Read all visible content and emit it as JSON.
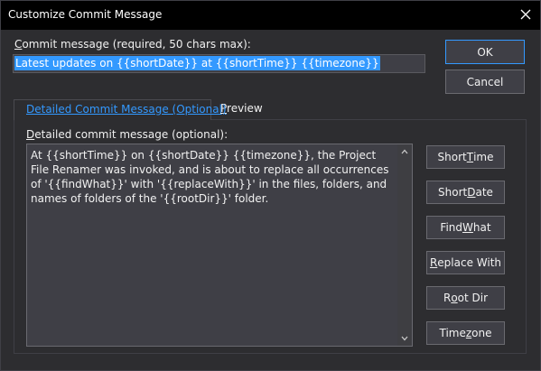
{
  "window": {
    "title": "Customize Commit Message"
  },
  "commit": {
    "label_accel": "C",
    "label_rest": "ommit message (required, 50 chars max):",
    "value": "Latest updates on {{shortDate}} at {{shortTime}} {{timezone}}"
  },
  "buttons": {
    "ok": "OK",
    "cancel": "Cancel"
  },
  "tabs": {
    "detailed": "Detailed Commit Message (Optional)",
    "preview_accel": "P",
    "preview_rest": "review"
  },
  "detail": {
    "label_accel": "D",
    "label_rest": "etailed commit message (optional):",
    "value": "At {{shortTime}} on {{shortDate}} {{timezone}}, the Project File Renamer was invoked, and is about to replace all occurrences of '{{findWhat}}' with '{{replaceWith}}' in the files, folders, and names of folders of the '{{rootDir}}' folder."
  },
  "token_buttons": {
    "short_time": {
      "pre": "Short ",
      "accel": "T",
      "post": "ime"
    },
    "short_date": {
      "pre": "Short ",
      "accel": "D",
      "post": "ate"
    },
    "find_what": {
      "pre": "Find ",
      "accel": "W",
      "post": "hat"
    },
    "replace_with": {
      "pre": "",
      "accel": "R",
      "post": "eplace With"
    },
    "root_dir": {
      "pre": "R",
      "accel": "o",
      "post": "ot Dir"
    },
    "timezone": {
      "pre": "Time",
      "accel": "z",
      "post": "one"
    }
  },
  "icons": {
    "close": "close-icon",
    "scroll_up": "chevron-up-icon",
    "scroll_down": "chevron-down-icon"
  },
  "colors": {
    "background": "#2d2d30",
    "titlebar": "#000000",
    "selection": "#3399ff",
    "active_tab_text": "#3399ff",
    "control": "#3f3f46"
  }
}
